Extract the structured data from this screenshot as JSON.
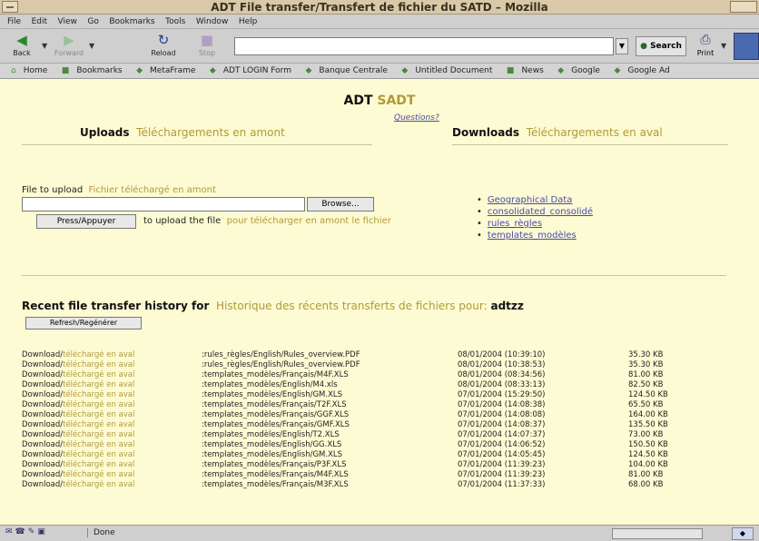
{
  "window": {
    "title": "ADT File transfer/Transfert de fichier du SATD – Mozilla"
  },
  "menu": [
    "File",
    "Edit",
    "View",
    "Go",
    "Bookmarks",
    "Tools",
    "Window",
    "Help"
  ],
  "nav": {
    "back": "Back",
    "forward": "Forward",
    "reload": "Reload",
    "stop": "Stop",
    "url": "",
    "search": "Search",
    "print": "Print"
  },
  "bookmarks": [
    "Home",
    "Bookmarks",
    "MetaFrame",
    "ADT LOGIN Form",
    "Banque Centrale",
    "Untitled Document",
    "News",
    "Google",
    "Google Ad"
  ],
  "page": {
    "heading_en": "ADT",
    "heading_fr": "SADT",
    "questions": "Questions?",
    "uploads_en": "Uploads",
    "uploads_fr": "Téléchargements en amont",
    "downloads_en": "Downloads",
    "downloads_fr": "Téléchargements en aval",
    "file_to_upload_en": "File to upload",
    "file_to_upload_fr": "Fichier téléchargé en amont",
    "browse": "Browse...",
    "press": "Press/Appuyer",
    "upload_note_en": "to upload the file",
    "upload_note_fr": "pour télécharger en amont le fichier",
    "download_links": [
      "Geographical Data",
      "consolidated_consolidé",
      "rules_règles",
      "templates_modèles"
    ],
    "recent_en": "Recent file transfer history for",
    "recent_fr": "Historique des récents transferts de fichiers pour:",
    "user": "adtzz",
    "refresh": "Refresh/Regénérer",
    "history_prefix_en": "Download/",
    "history_prefix_fr": "téléchargé en aval",
    "history": [
      {
        "file": ":rules_règles/English/Rules_overview.PDF",
        "date": "08/01/2004 (10:39:10)",
        "size": "35.30 KB"
      },
      {
        "file": ":rules_règles/English/Rules_overview.PDF",
        "date": "08/01/2004 (10:38:53)",
        "size": "35.30 KB"
      },
      {
        "file": ":templates_modèles/Français/M4F.XLS",
        "date": "08/01/2004 (08:34:56)",
        "size": "81.00 KB"
      },
      {
        "file": ":templates_modèles/English/M4.xls",
        "date": "08/01/2004 (08:33:13)",
        "size": "82.50 KB"
      },
      {
        "file": ":templates_modèles/English/GM.XLS",
        "date": "07/01/2004 (15:29:50)",
        "size": "124.50 KB"
      },
      {
        "file": ":templates_modèles/Français/T2F.XLS",
        "date": "07/01/2004 (14:08:38)",
        "size": "65.50 KB"
      },
      {
        "file": ":templates_modèles/Français/GGF.XLS",
        "date": "07/01/2004 (14:08:08)",
        "size": "164.00 KB"
      },
      {
        "file": ":templates_modèles/Français/GMF.XLS",
        "date": "07/01/2004 (14:08:37)",
        "size": "135.50 KB"
      },
      {
        "file": ":templates_modèles/English/T2.XLS",
        "date": "07/01/2004 (14:07:37)",
        "size": "73.00 KB"
      },
      {
        "file": ":templates_modèles/English/GG.XLS",
        "date": "07/01/2004 (14:06:52)",
        "size": "150.50 KB"
      },
      {
        "file": ":templates_modèles/English/GM.XLS",
        "date": "07/01/2004 (14:05:45)",
        "size": "124.50 KB"
      },
      {
        "file": ":templates_modèles/Français/P3F.XLS",
        "date": "07/01/2004 (11:39:23)",
        "size": "104.00 KB"
      },
      {
        "file": ":templates_modèles/Français/M4F.XLS",
        "date": "07/01/2004 (11:39:23)",
        "size": "81.00 KB"
      },
      {
        "file": ":templates_modèles/Français/M3F.XLS",
        "date": "07/01/2004 (11:37:33)",
        "size": "68.00 KB"
      }
    ]
  },
  "status": {
    "text": "Done"
  },
  "colors": {
    "page_bg": "#fdfbd3",
    "french_text": "#b09a38",
    "link": "#4a4aaa"
  }
}
